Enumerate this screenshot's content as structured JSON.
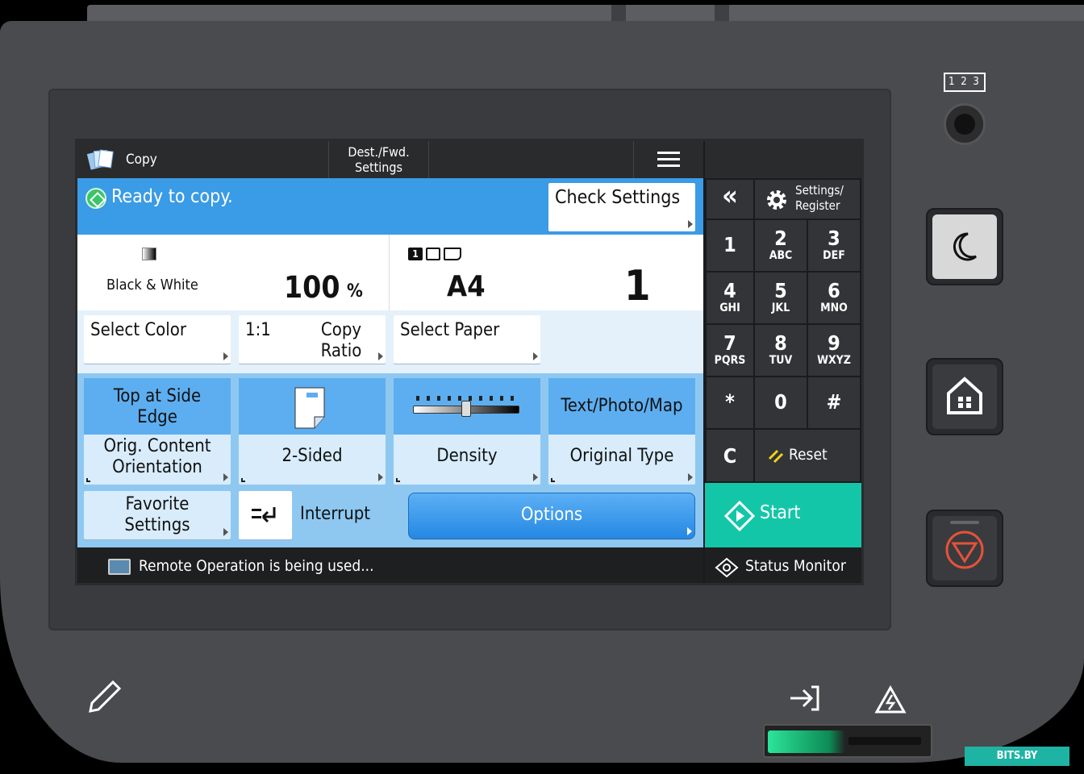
{
  "header": {
    "app_title": "Copy",
    "dest_settings": "Dest./Fwd. Settings",
    "menu_icon": "menu-icon"
  },
  "status": {
    "message": "Ready to copy.",
    "check_settings": "Check Settings"
  },
  "summary": {
    "color_mode": "Black & White",
    "ratio_value": "100",
    "ratio_unit": "%",
    "paper_size": "A4",
    "copies": "1"
  },
  "row1": {
    "select_color": "Select Color",
    "copy_ratio_value": "1:1",
    "copy_ratio_label": "Copy Ratio",
    "select_paper": "Select Paper"
  },
  "functions": [
    {
      "top": "Top at Side Edge",
      "label": "Orig. Content Orientation"
    },
    {
      "top": "",
      "label": "2-Sided"
    },
    {
      "top": "",
      "label": "Density",
      "level": 0.5
    },
    {
      "top": "Text/Photo/Map",
      "label": "Original Type"
    }
  ],
  "bottom": {
    "favorite": "Favorite Settings",
    "interrupt": "Interrupt",
    "options": "Options"
  },
  "footer": {
    "remote": "Remote Operation is being used...",
    "status_monitor": "Status Monitor"
  },
  "keypad": {
    "back": "«",
    "settings": "Settings/ Register",
    "keys": [
      {
        "d": "1",
        "l": ""
      },
      {
        "d": "2",
        "l": "ABC"
      },
      {
        "d": "3",
        "l": "DEF"
      },
      {
        "d": "4",
        "l": "GHI"
      },
      {
        "d": "5",
        "l": "JKL"
      },
      {
        "d": "6",
        "l": "MNO"
      },
      {
        "d": "7",
        "l": "PQRS"
      },
      {
        "d": "8",
        "l": "TUV"
      },
      {
        "d": "9",
        "l": "WXYZ"
      },
      {
        "d": "*",
        "l": ""
      },
      {
        "d": "0",
        "l": ""
      },
      {
        "d": "#",
        "l": ""
      }
    ],
    "clear": "C",
    "reset": "Reset",
    "start": "Start"
  },
  "device": {
    "counter": "1 2 3",
    "watermark": "BITS.BY"
  },
  "colors": {
    "status_blue": "#3a9be6",
    "start_teal": "#14c6a8",
    "func_blue": "#5daef0"
  }
}
